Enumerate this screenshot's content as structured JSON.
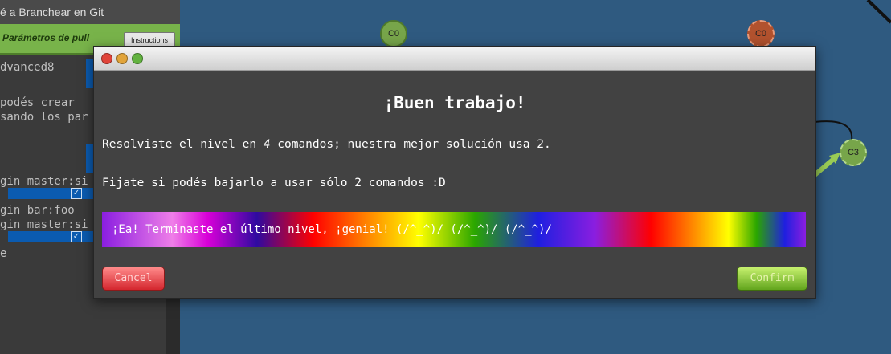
{
  "sidebar": {
    "title": "é a Branchear en Git",
    "tab_label": "Parámetros de pull",
    "instructions_label": "Instructions",
    "code_lines": [
      "dvanced8",
      " podés crear",
      "sando los par",
      "gin master:si",
      "gin bar:foo",
      "gin master:si",
      "e"
    ]
  },
  "tree": {
    "nodes": [
      "C0",
      "C0",
      "C3"
    ]
  },
  "modal": {
    "title": "¡Buen trabajo!",
    "line1_pre": "Resolviste el nivel en ",
    "line1_count": "4",
    "line1_post": " comandos; nuestra mejor solución usa 2.",
    "line2": "Fijate si podés bajarlo a usar sólo 2 comandos :D",
    "banner": "¡Ea! Terminaste el último nivel, ¡genial! (/^_^)/ (/^_^)/ (/^_^)/",
    "cancel_label": "Cancel",
    "confirm_label": "Confirm"
  },
  "colors": {
    "background": "#2f5a80",
    "modal_bg": "#424242",
    "cancel": "#d4262e",
    "confirm": "#62a51d"
  }
}
